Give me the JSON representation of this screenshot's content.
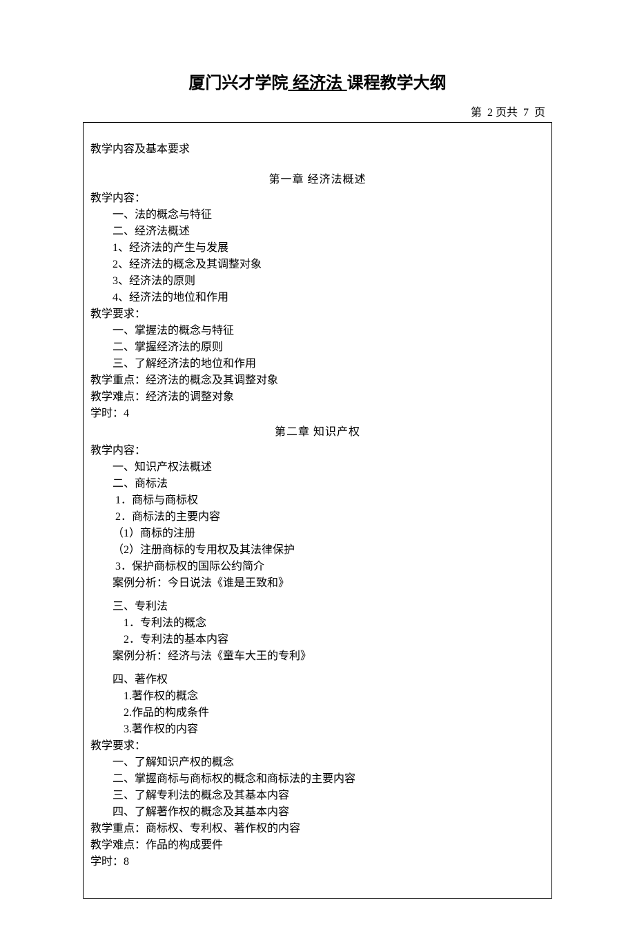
{
  "header": {
    "institution": "厦门兴才学院",
    "course": " 经济法 ",
    "suffix": "课程教学大纲"
  },
  "page_number": {
    "prefix": "第",
    "current": "2",
    "middle": "页共",
    "total": "7",
    "suffix": "页"
  },
  "section_label": "教学内容及基本要求",
  "chapter1": {
    "title": "第一章    经济法概述",
    "lines": [
      {
        "cls": "indent-0",
        "text": "教学内容："
      },
      {
        "cls": "indent-1",
        "text": "一、法的概念与特征"
      },
      {
        "cls": "indent-1",
        "text": "二、经济法概述"
      },
      {
        "cls": "indent-1",
        "text": "1、经济法的产生与发展"
      },
      {
        "cls": "indent-1",
        "text": "2、经济法的概念及其调整对象"
      },
      {
        "cls": "indent-1",
        "text": "3、经济法的原则"
      },
      {
        "cls": "indent-1",
        "text": "4、经济法的地位和作用"
      },
      {
        "cls": "indent-0",
        "text": "教学要求："
      },
      {
        "cls": "indent-1",
        "text": "一、掌握法的概念与特征"
      },
      {
        "cls": "indent-1",
        "text": "二、掌握经济法的原则"
      },
      {
        "cls": "indent-1",
        "text": "三、了解经济法的地位和作用"
      },
      {
        "cls": "indent-0",
        "text": "教学重点：经济法的概念及其调整对象"
      },
      {
        "cls": "indent-0",
        "text": "教学难点：经济法的调整对象"
      },
      {
        "cls": "indent-0",
        "text": "学时：4"
      }
    ]
  },
  "chapter2": {
    "title": "第二章    知识产权",
    "lines": [
      {
        "cls": "indent-0",
        "text": "教学内容："
      },
      {
        "cls": "indent-1",
        "text": "一、知识产权法概述"
      },
      {
        "cls": "indent-1",
        "text": "二、商标法"
      },
      {
        "cls": "indent-1",
        "text": " 1．商标与商标权"
      },
      {
        "cls": "indent-1",
        "text": " 2．商标法的主要内容"
      },
      {
        "cls": "indent-1",
        "text": "（1）商标的注册"
      },
      {
        "cls": "indent-1",
        "text": "（2）注册商标的专用权及其法律保护"
      },
      {
        "cls": "indent-1",
        "text": " 3．保护商标权的国际公约简介"
      },
      {
        "cls": "indent-1",
        "text": "案例分析：今日说法《谁是王致和》"
      },
      {
        "cls": "spacer",
        "text": ""
      },
      {
        "cls": "indent-1",
        "text": "三、专利法"
      },
      {
        "cls": "indent-2",
        "text": "1．专利法的概念"
      },
      {
        "cls": "indent-2",
        "text": "2．专利法的基本内容"
      },
      {
        "cls": "indent-1",
        "text": "案例分析：经济与法《童车大王的专利》"
      },
      {
        "cls": "spacer",
        "text": ""
      },
      {
        "cls": "indent-1",
        "text": "四、著作权"
      },
      {
        "cls": "indent-2",
        "text": "1.著作权的概念"
      },
      {
        "cls": "indent-2",
        "text": "2.作品的构成条件"
      },
      {
        "cls": "indent-2",
        "text": "3.著作权的内容"
      },
      {
        "cls": "indent-0",
        "text": "教学要求："
      },
      {
        "cls": "indent-1",
        "text": "一、了解知识产权的概念"
      },
      {
        "cls": "indent-1",
        "text": "二、掌握商标与商标权的概念和商标法的主要内容"
      },
      {
        "cls": "indent-1",
        "text": "三、了解专利法的概念及其基本内容"
      },
      {
        "cls": "indent-1",
        "text": "四、了解著作权的概念及其基本内容"
      },
      {
        "cls": "indent-0",
        "text": "教学重点：商标权、专利权、著作权的内容"
      },
      {
        "cls": "indent-0",
        "text": "教学难点：作品的构成要件"
      },
      {
        "cls": "indent-0",
        "text": "学时：8"
      }
    ]
  }
}
